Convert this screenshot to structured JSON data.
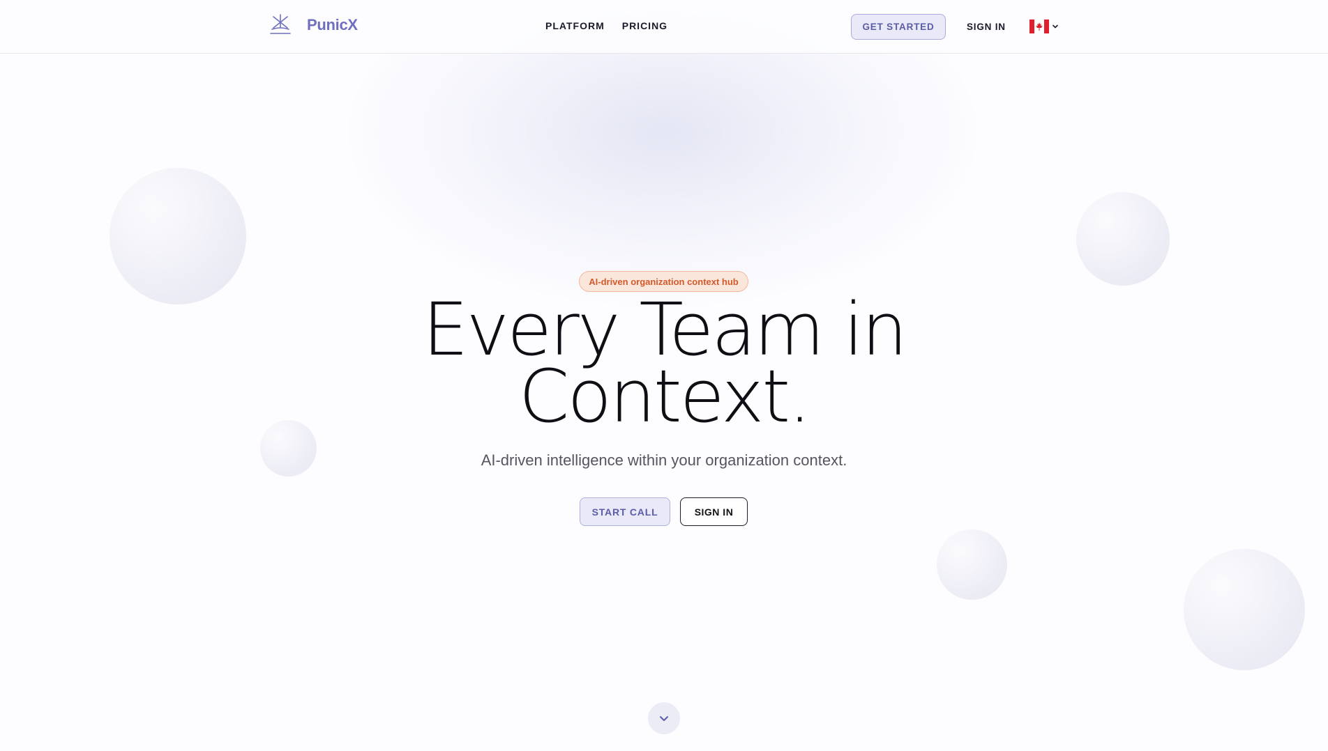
{
  "header": {
    "brand": "PunicX",
    "nav": [
      {
        "label": "PLATFORM"
      },
      {
        "label": "PRICING"
      }
    ],
    "get_started_label": "GET STARTED",
    "sign_in_label": "SIGN IN",
    "language_icon": "canada-flag-icon"
  },
  "hero": {
    "tagline": "AI-driven organization context hub",
    "title_line1": "Every Team in",
    "title_line2": "Context.",
    "subtitle": "AI-driven intelligence within your organization context.",
    "start_call_label": "START CALL",
    "sign_in_label": "SIGN IN",
    "scroll_icon": "chevron-down-icon"
  },
  "colors": {
    "brand": "#6f6fbf",
    "accent_bg": "#e9e9f8",
    "tag_bg": "#fbe6dc",
    "tag_text": "#d25a2a"
  }
}
